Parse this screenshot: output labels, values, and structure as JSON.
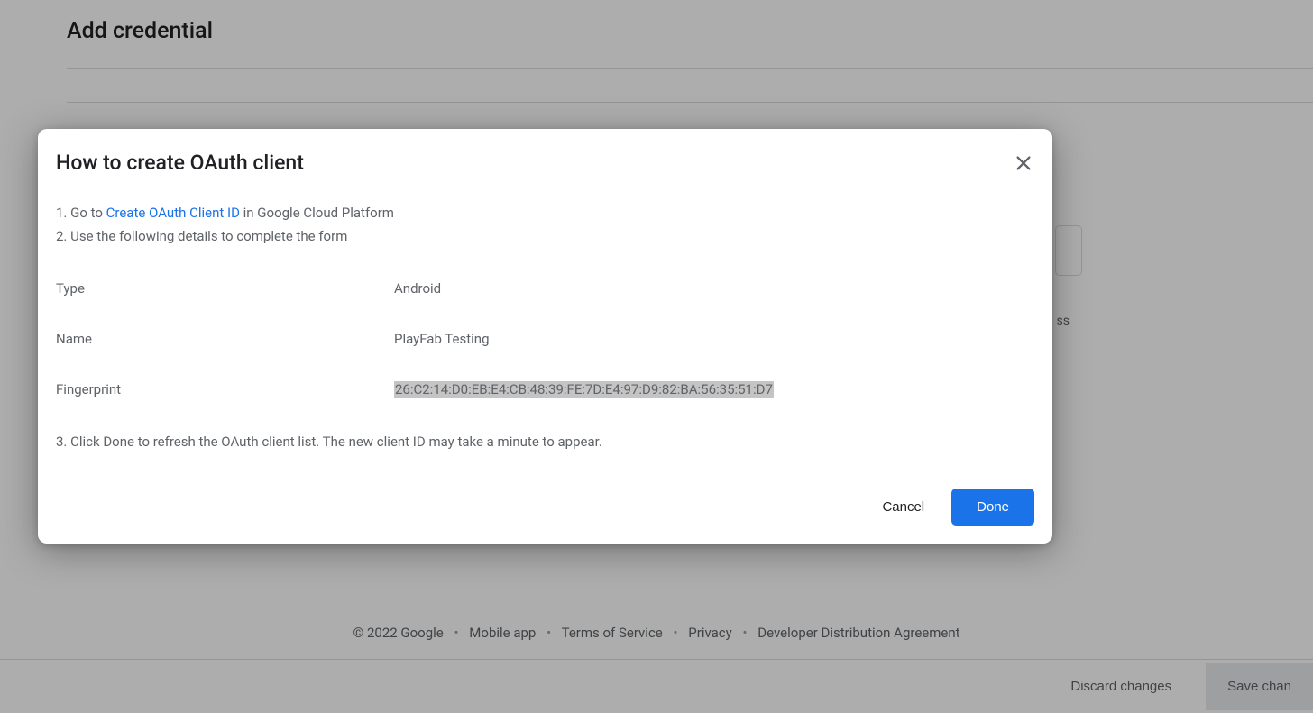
{
  "page": {
    "title": "Add credential",
    "bgText": "ss"
  },
  "dialog": {
    "title": "How to create OAuth client",
    "step1_prefix": "1. Go to ",
    "step1_link": "Create OAuth Client ID",
    "step1_suffix": " in Google Cloud Platform",
    "step2": "2. Use the following details to complete the form",
    "labels": {
      "type": "Type",
      "name": "Name",
      "fingerprint": "Fingerprint"
    },
    "values": {
      "type": "Android",
      "name": "PlayFab Testing",
      "fingerprint": "26:C2:14:D0:EB:E4:CB:48:39:FE:7D:E4:97:D9:82:BA:56:35:51:D7"
    },
    "step3": "3. Click Done to refresh the OAuth client list. The new client ID may take a minute to appear.",
    "cancel": "Cancel",
    "done": "Done"
  },
  "footer": {
    "copyright": "© 2022 Google",
    "mobile": "Mobile app",
    "terms": "Terms of Service",
    "privacy": "Privacy",
    "dda": "Developer Distribution Agreement"
  },
  "bottomBar": {
    "discard": "Discard changes",
    "save": "Save chan"
  }
}
